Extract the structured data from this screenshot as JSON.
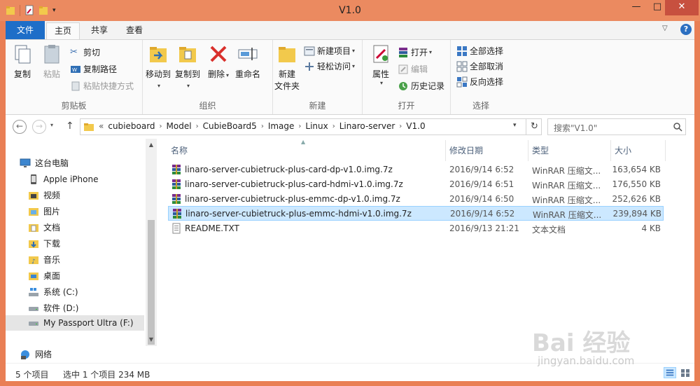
{
  "window": {
    "title": "V1.0",
    "controls": {
      "minimize": "—",
      "maximize": "□",
      "close": "✕"
    }
  },
  "ribbon": {
    "tabs": [
      {
        "label": "文件",
        "state": "file"
      },
      {
        "label": "主页",
        "state": "active"
      },
      {
        "label": "共享",
        "state": "inactive"
      },
      {
        "label": "查看",
        "state": "inactive"
      }
    ],
    "help_label": "?",
    "groups": {
      "clipboard": {
        "label": "剪贴板",
        "copy": "复制",
        "paste": "粘贴",
        "cut": "剪切",
        "copy_path": "复制路径",
        "paste_shortcut": "粘贴快捷方式"
      },
      "organize": {
        "label": "组织",
        "move_to": "移动到",
        "copy_to": "复制到",
        "delete": "删除",
        "rename": "重命名"
      },
      "new": {
        "label": "新建",
        "new_folder_line1": "新建",
        "new_folder_line2": "文件夹",
        "new_item": "新建项目",
        "easy_access": "轻松访问"
      },
      "open": {
        "label": "打开",
        "properties": "属性",
        "open": "打开",
        "edit": "编辑",
        "history": "历史记录"
      },
      "select": {
        "label": "选择",
        "select_all": "全部选择",
        "select_none": "全部取消",
        "invert": "反向选择"
      }
    }
  },
  "navigation": {
    "back": "←",
    "forward": "→",
    "up": "↑",
    "breadcrumb_prefix": "«",
    "breadcrumbs": [
      "cubieboard",
      "Model",
      "CubieBoard5",
      "Image",
      "Linux",
      "Linaro-server",
      "V1.0"
    ],
    "search_placeholder": "搜索\"V1.0\""
  },
  "sidebar": {
    "items": [
      {
        "label": "这台电脑",
        "icon": "computer-icon",
        "indent": 0
      },
      {
        "label": "Apple iPhone",
        "icon": "phone-icon",
        "indent": 1
      },
      {
        "label": "视频",
        "icon": "videos-folder-icon",
        "indent": 1
      },
      {
        "label": "图片",
        "icon": "pictures-folder-icon",
        "indent": 1
      },
      {
        "label": "文档",
        "icon": "documents-folder-icon",
        "indent": 1
      },
      {
        "label": "下载",
        "icon": "downloads-folder-icon",
        "indent": 1
      },
      {
        "label": "音乐",
        "icon": "music-folder-icon",
        "indent": 1
      },
      {
        "label": "桌面",
        "icon": "desktop-folder-icon",
        "indent": 1
      },
      {
        "label": "系统 (C:)",
        "icon": "system-drive-icon",
        "indent": 1
      },
      {
        "label": "软件 (D:)",
        "icon": "drive-icon",
        "indent": 1
      },
      {
        "label": "My Passport Ultra (F:)",
        "icon": "drive-icon",
        "indent": 1,
        "selected": true
      },
      {
        "label": "网络",
        "icon": "network-icon",
        "indent": 0
      }
    ]
  },
  "file_list": {
    "columns": {
      "name": "名称",
      "date": "修改日期",
      "type": "类型",
      "size": "大小"
    },
    "rows": [
      {
        "name": "linaro-server-cubietruck-plus-card-dp-v1.0.img.7z",
        "date": "2016/9/14 6:52",
        "type": "WinRAR 压缩文...",
        "size": "163,654 KB",
        "icon": "winrar-archive-icon"
      },
      {
        "name": "linaro-server-cubietruck-plus-card-hdmi-v1.0.img.7z",
        "date": "2016/9/14 6:51",
        "type": "WinRAR 压缩文...",
        "size": "176,550 KB",
        "icon": "winrar-archive-icon"
      },
      {
        "name": "linaro-server-cubietruck-plus-emmc-dp-v1.0.img.7z",
        "date": "2016/9/14 6:50",
        "type": "WinRAR 压缩文...",
        "size": "252,626 KB",
        "icon": "winrar-archive-icon"
      },
      {
        "name": "linaro-server-cubietruck-plus-emmc-hdmi-v1.0.img.7z",
        "date": "2016/9/14 6:52",
        "type": "WinRAR 压缩文...",
        "size": "239,894 KB",
        "icon": "winrar-archive-icon",
        "selected": true
      },
      {
        "name": "README.TXT",
        "date": "2016/9/13 21:21",
        "type": "文本文档",
        "size": "4 KB",
        "icon": "text-file-icon"
      }
    ]
  },
  "status": {
    "item_count": "5 个项目",
    "selection": "选中 1 个项目  234 MB"
  },
  "watermark": {
    "logo": "Bai  经验",
    "url": "jingyan.baidu.com"
  },
  "colors": {
    "frame": "#e97f55",
    "file_tab": "#1e6ec8",
    "selection": "#cce8ff",
    "close_button": "#c7503f"
  }
}
